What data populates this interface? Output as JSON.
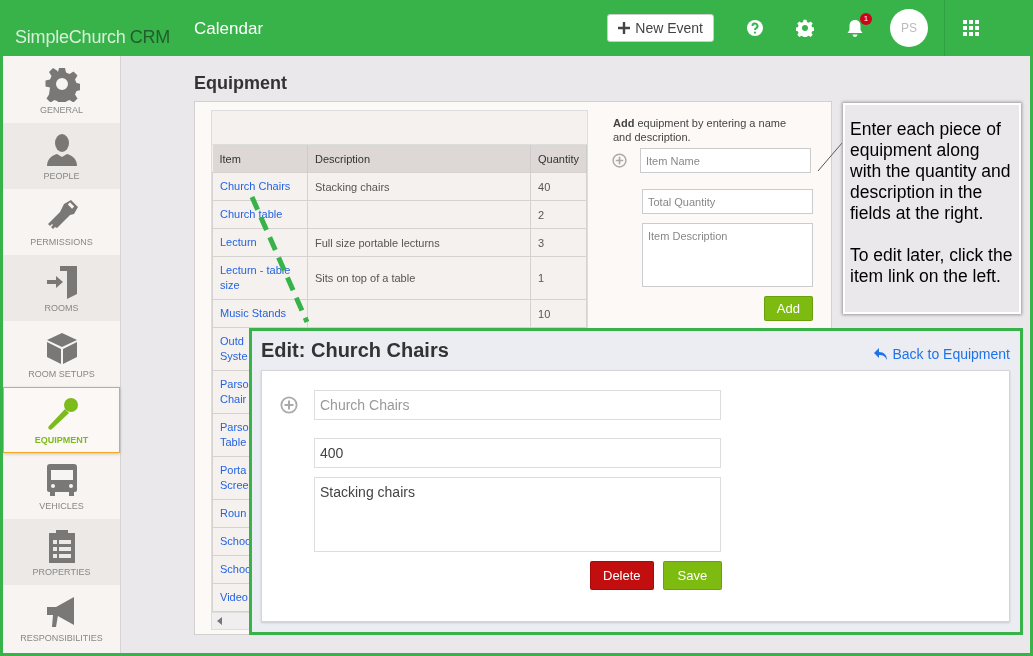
{
  "topbar": {
    "brand": "SimpleChurch",
    "brand_suffix": "CRM",
    "page_title": "Calendar",
    "new_event": "New Event",
    "notification_count": "1",
    "avatar": "PS"
  },
  "sidebar": [
    {
      "label": "GENERAL",
      "kind": "gear",
      "selected": false
    },
    {
      "label": "PEOPLE",
      "kind": "person",
      "selected": false
    },
    {
      "label": "PERMISSIONS",
      "kind": "key",
      "selected": false
    },
    {
      "label": "ROOMS",
      "kind": "door",
      "selected": false
    },
    {
      "label": "ROOM SETUPS",
      "kind": "cube",
      "selected": false
    },
    {
      "label": "EQUIPMENT",
      "kind": "microphone",
      "selected": true
    },
    {
      "label": "VEHICLES",
      "kind": "bus",
      "selected": false
    },
    {
      "label": "PROPERTIES",
      "kind": "clipboard",
      "selected": false
    },
    {
      "label": "RESPONSIBILITIES",
      "kind": "megaphone",
      "selected": false
    }
  ],
  "equipment": {
    "title": "Equipment",
    "columns": [
      "Item",
      "Description",
      "Quantity"
    ],
    "rows": [
      {
        "item": [
          "Church Chairs"
        ],
        "description": "Stacking chairs",
        "quantity": "40"
      },
      {
        "item": [
          "Church table"
        ],
        "quantity": "2"
      },
      {
        "item": [
          "Lecturn"
        ],
        "description": "Full size portable lecturns",
        "quantity": "3"
      },
      {
        "item": [
          "Lecturn - table",
          "size"
        ],
        "description": "Sits on top of a table",
        "quantity": "1"
      },
      {
        "item": [
          "Music Stands"
        ],
        "quantity": "10"
      },
      {
        "item": [
          "Outd",
          "Syste"
        ]
      },
      {
        "item": [
          "Parso",
          "Chair"
        ]
      },
      {
        "item": [
          "Parso",
          "Table"
        ]
      },
      {
        "item": [
          "Porta",
          "Scree"
        ]
      },
      {
        "item": [
          "Roun"
        ]
      },
      {
        "item": [
          "Schoo"
        ]
      },
      {
        "item": [
          "Schoo"
        ]
      },
      {
        "item": [
          "Video"
        ]
      }
    ]
  },
  "add_form": {
    "intro": "**Add** equipment by entering a name and description.",
    "name_placeholder": "Item Name",
    "quantity_placeholder": "Total Quantity",
    "description_placeholder": "Item Description",
    "button": "Add"
  },
  "callout": {
    "paragraphs": [
      "Enter each piece of equipment along with the quantity and description in the fields at the right.",
      "To edit later, click the item link on the left."
    ]
  },
  "edit": {
    "title": "Edit: Church Chairs",
    "back": "Back to Equipment",
    "name_placeholder": "Church Chairs",
    "quantity": "400",
    "description": "Stacking chairs",
    "delete": "Delete",
    "save": "Save"
  }
}
